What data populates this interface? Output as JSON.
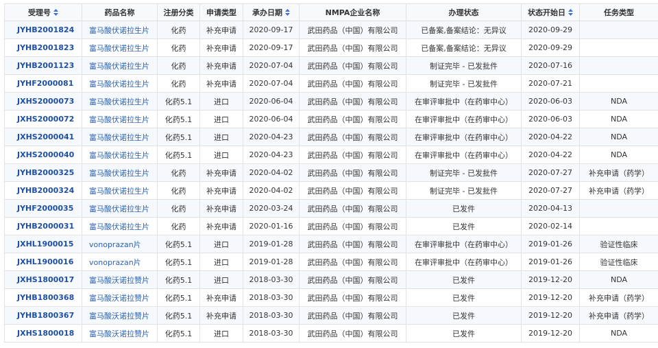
{
  "columns": [
    {
      "label": "受理号",
      "sortable": true
    },
    {
      "label": "药品名称",
      "sortable": false
    },
    {
      "label": "注册分类",
      "sortable": false
    },
    {
      "label": "申请类型",
      "sortable": false
    },
    {
      "label": "承办日期",
      "sortable": true
    },
    {
      "label": "NMPA企业名称",
      "sortable": false
    },
    {
      "label": "办理状态",
      "sortable": false
    },
    {
      "label": "状态开始日",
      "sortable": true
    },
    {
      "label": "任务类型",
      "sortable": false
    }
  ],
  "rows": [
    {
      "acceptance_no": "JYHB2001824",
      "drug_name": "富马酸伏诺拉生片",
      "reg_class": "化药",
      "app_type": "补充申请",
      "undertake_date": "2020-09-17",
      "company": "武田药品（中国）有限公司",
      "status": "已备案,备案结论：无异议",
      "status_start": "2020-09-29",
      "task_type": ""
    },
    {
      "acceptance_no": "JYHB2001823",
      "drug_name": "富马酸伏诺拉生片",
      "reg_class": "化药",
      "app_type": "补充申请",
      "undertake_date": "2020-09-17",
      "company": "武田药品（中国）有限公司",
      "status": "已备案,备案结论：无异议",
      "status_start": "2020-09-29",
      "task_type": ""
    },
    {
      "acceptance_no": "JYHB2001123",
      "drug_name": "富马酸伏诺拉生片",
      "reg_class": "化药",
      "app_type": "补充申请",
      "undertake_date": "2020-07-04",
      "company": "武田药品（中国）有限公司",
      "status": "制证完毕 - 已发批件",
      "status_start": "2020-07-16",
      "task_type": ""
    },
    {
      "acceptance_no": "JYHF2000081",
      "drug_name": "富马酸伏诺拉生片",
      "reg_class": "化药",
      "app_type": "补充申请",
      "undertake_date": "2020-07-04",
      "company": "武田药品（中国）有限公司",
      "status": "制证完毕 - 已发批件",
      "status_start": "2020-07-21",
      "task_type": ""
    },
    {
      "acceptance_no": "JXHS2000073",
      "drug_name": "富马酸伏诺拉生片",
      "reg_class": "化药5.1",
      "app_type": "进口",
      "undertake_date": "2020-06-04",
      "company": "武田药品（中国）有限公司",
      "status": "在审评审批中（在药审中心）",
      "status_start": "2020-06-03",
      "task_type": "NDA"
    },
    {
      "acceptance_no": "JXHS2000072",
      "drug_name": "富马酸伏诺拉生片",
      "reg_class": "化药5.1",
      "app_type": "进口",
      "undertake_date": "2020-06-04",
      "company": "武田药品（中国）有限公司",
      "status": "在审评审批中（在药审中心）",
      "status_start": "2020-06-03",
      "task_type": "NDA"
    },
    {
      "acceptance_no": "JXHS2000041",
      "drug_name": "富马酸伏诺拉生片",
      "reg_class": "化药5.1",
      "app_type": "进口",
      "undertake_date": "2020-04-23",
      "company": "武田药品（中国）有限公司",
      "status": "在审评审批中（在药审中心）",
      "status_start": "2020-04-22",
      "task_type": "NDA"
    },
    {
      "acceptance_no": "JXHS2000040",
      "drug_name": "富马酸伏诺拉生片",
      "reg_class": "化药5.1",
      "app_type": "进口",
      "undertake_date": "2020-04-23",
      "company": "武田药品（中国）有限公司",
      "status": "在审评审批中（在药审中心）",
      "status_start": "2020-04-22",
      "task_type": "NDA"
    },
    {
      "acceptance_no": "JYHB2000325",
      "drug_name": "富马酸伏诺拉生片",
      "reg_class": "化药",
      "app_type": "补充申请",
      "undertake_date": "2020-04-02",
      "company": "武田药品（中国）有限公司",
      "status": "制证完毕 - 已发批件",
      "status_start": "2020-07-27",
      "task_type": "补充申请（药学）"
    },
    {
      "acceptance_no": "JYHB2000324",
      "drug_name": "富马酸伏诺拉生片",
      "reg_class": "化药",
      "app_type": "补充申请",
      "undertake_date": "2020-04-02",
      "company": "武田药品（中国）有限公司",
      "status": "制证完毕 - 已发批件",
      "status_start": "2020-07-27",
      "task_type": "补充申请（药学）"
    },
    {
      "acceptance_no": "JYHF2000035",
      "drug_name": "富马酸伏诺拉生片",
      "reg_class": "化药",
      "app_type": "补充申请",
      "undertake_date": "2020-03-24",
      "company": "武田药品（中国）有限公司",
      "status": "已发件",
      "status_start": "2020-04-13",
      "task_type": ""
    },
    {
      "acceptance_no": "JYHB2000031",
      "drug_name": "富马酸伏诺拉生片",
      "reg_class": "化药",
      "app_type": "补充申请",
      "undertake_date": "2020-01-16",
      "company": "武田药品（中国）有限公司",
      "status": "已发件",
      "status_start": "2020-02-14",
      "task_type": ""
    },
    {
      "acceptance_no": "JXHL1900015",
      "drug_name": "vonoprazan片",
      "reg_class": "化药5.1",
      "app_type": "进口",
      "undertake_date": "2019-01-28",
      "company": "武田药品（中国）有限公司",
      "status": "在审评审批中（在药审中心）",
      "status_start": "2019-01-26",
      "task_type": "验证性临床"
    },
    {
      "acceptance_no": "JXHL1900016",
      "drug_name": "vonoprazan片",
      "reg_class": "化药5.1",
      "app_type": "进口",
      "undertake_date": "2019-01-28",
      "company": "武田药品（中国）有限公司",
      "status": "在审评审批中（在药审中心）",
      "status_start": "2019-01-26",
      "task_type": "验证性临床"
    },
    {
      "acceptance_no": "JXHS1800017",
      "drug_name": "富马酸沃诺拉赞片",
      "reg_class": "化药5.1",
      "app_type": "进口",
      "undertake_date": "2018-03-30",
      "company": "武田药品（中国）有限公司",
      "status": "已发件",
      "status_start": "2019-12-20",
      "task_type": "NDA"
    },
    {
      "acceptance_no": "JYHB1800368",
      "drug_name": "富马酸沃诺拉赞片",
      "reg_class": "化药5.1",
      "app_type": "补充申请",
      "undertake_date": "2018-03-30",
      "company": "武田药品（中国）有限公司",
      "status": "已发件",
      "status_start": "2019-12-20",
      "task_type": "补充申请（药学）"
    },
    {
      "acceptance_no": "JYHB1800367",
      "drug_name": "富马酸沃诺拉赞片",
      "reg_class": "化药5.1",
      "app_type": "补充申请",
      "undertake_date": "2018-03-30",
      "company": "武田药品（中国）有限公司",
      "status": "已发件",
      "status_start": "2019-12-20",
      "task_type": "补充申请（药学）"
    },
    {
      "acceptance_no": "JXHS1800018",
      "drug_name": "富马酸沃诺拉赞片",
      "reg_class": "化药5.1",
      "app_type": "进口",
      "undertake_date": "2018-03-30",
      "company": "武田药品（中国）有限公司",
      "status": "已发件",
      "status_start": "2019-12-20",
      "task_type": "NDA"
    }
  ]
}
